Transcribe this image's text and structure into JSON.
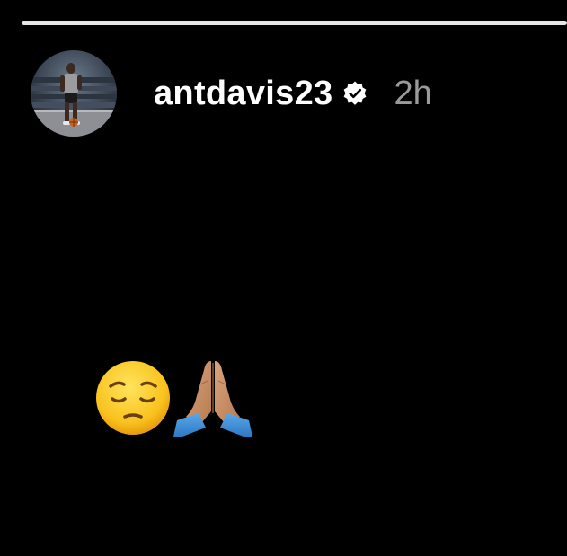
{
  "story": {
    "progress": 1.0,
    "username": "antdavis23",
    "timestamp": "2h",
    "verified": true,
    "avatar_icon": "profile-photo-basketball-player",
    "content_emojis": [
      "pensive-face-emoji",
      "folded-hands-emoji"
    ]
  },
  "colors": {
    "background": "#000000",
    "username": "#ffffff",
    "timestamp": "#9a9a9a",
    "progress_fill": "#e6e6e6"
  }
}
